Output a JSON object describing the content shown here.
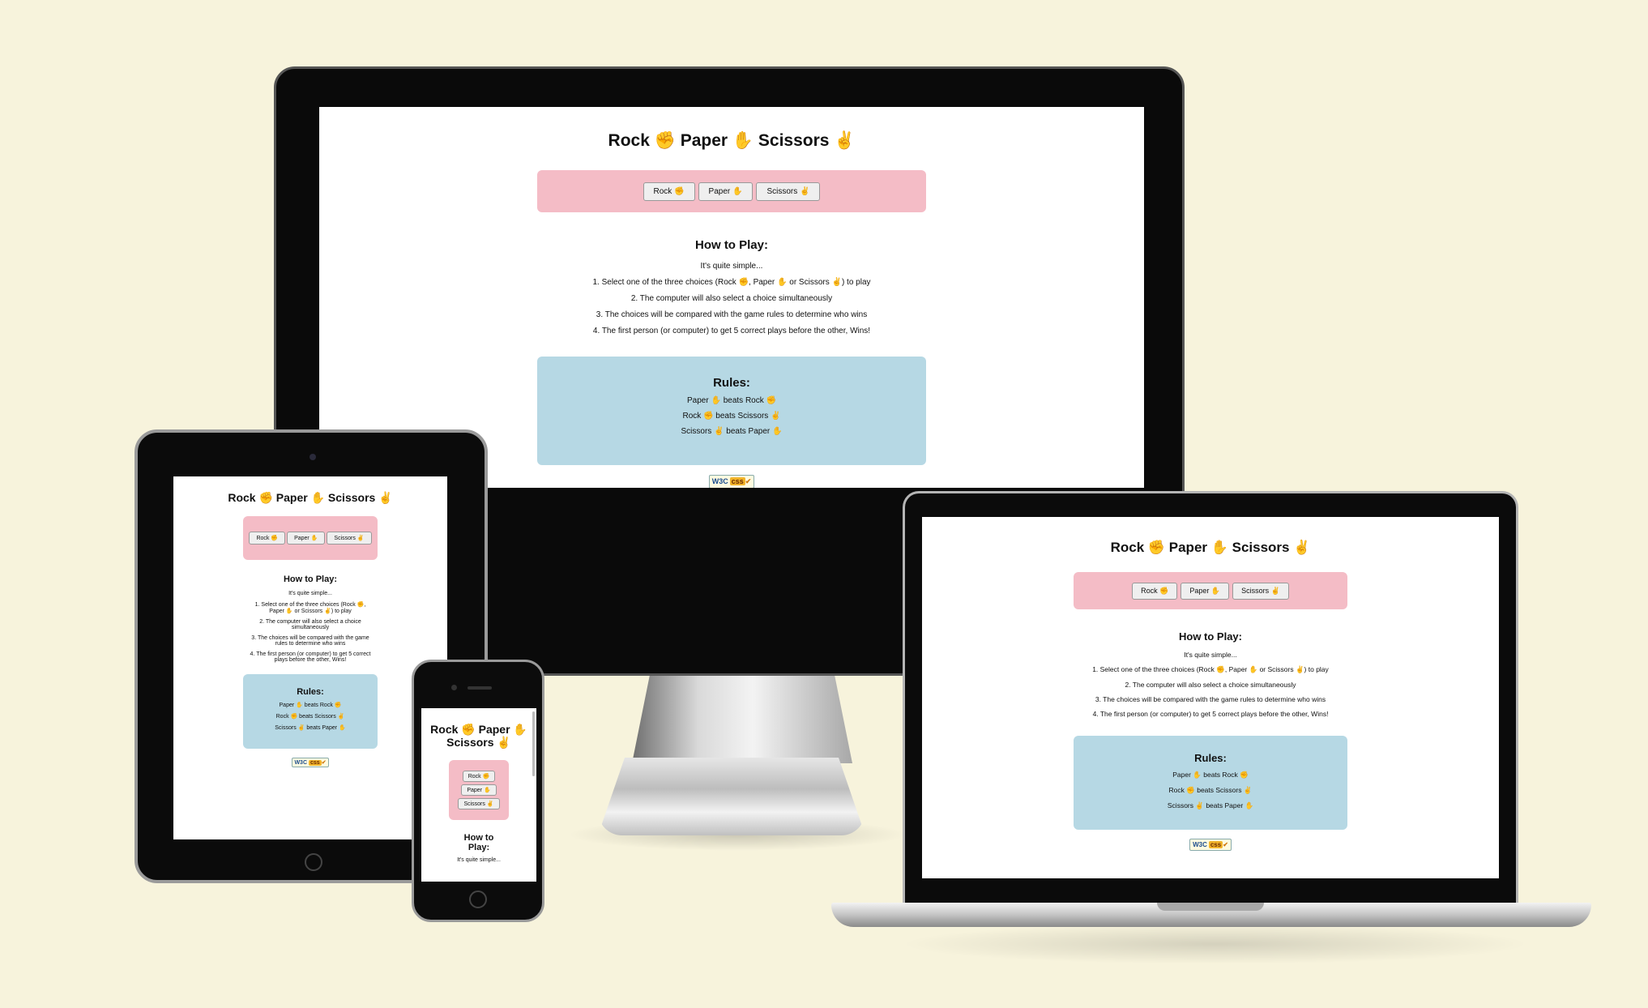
{
  "title": "Rock ✊ Paper ✋ Scissors ✌",
  "buttons": {
    "rock": "Rock ✊",
    "paper": "Paper ✋",
    "scissors": "Scissors ✌"
  },
  "how_to": {
    "heading": "How to Play:",
    "intro": "It's quite simple...",
    "steps": [
      "1. Select one of the three choices (Rock ✊, Paper ✋ or Scissors ✌) to play",
      "2. The computer will also select a choice simultaneously",
      "3. The choices will be compared with the game rules to determine who wins",
      "4. The first person (or computer) to get 5 correct plays before the other, Wins!"
    ]
  },
  "rules": {
    "heading": "Rules:",
    "items": [
      "Paper ✋ beats Rock ✊",
      "Rock ✊ beats Scissors ✌",
      "Scissors ✌ beats Paper ✋"
    ]
  },
  "badge": {
    "w3c": "W3C",
    "css": "css",
    "check": "✔"
  },
  "phone_title": {
    "line1": "Rock ✊ Paper ✋",
    "line2": "Scissors ✌"
  },
  "phone_how_to": {
    "line1": "How to",
    "line2": "Play:"
  },
  "colors": {
    "background": "#f7f3dc",
    "button_bar": "#f4bcc6",
    "rules_box": "#b6d8e4"
  }
}
